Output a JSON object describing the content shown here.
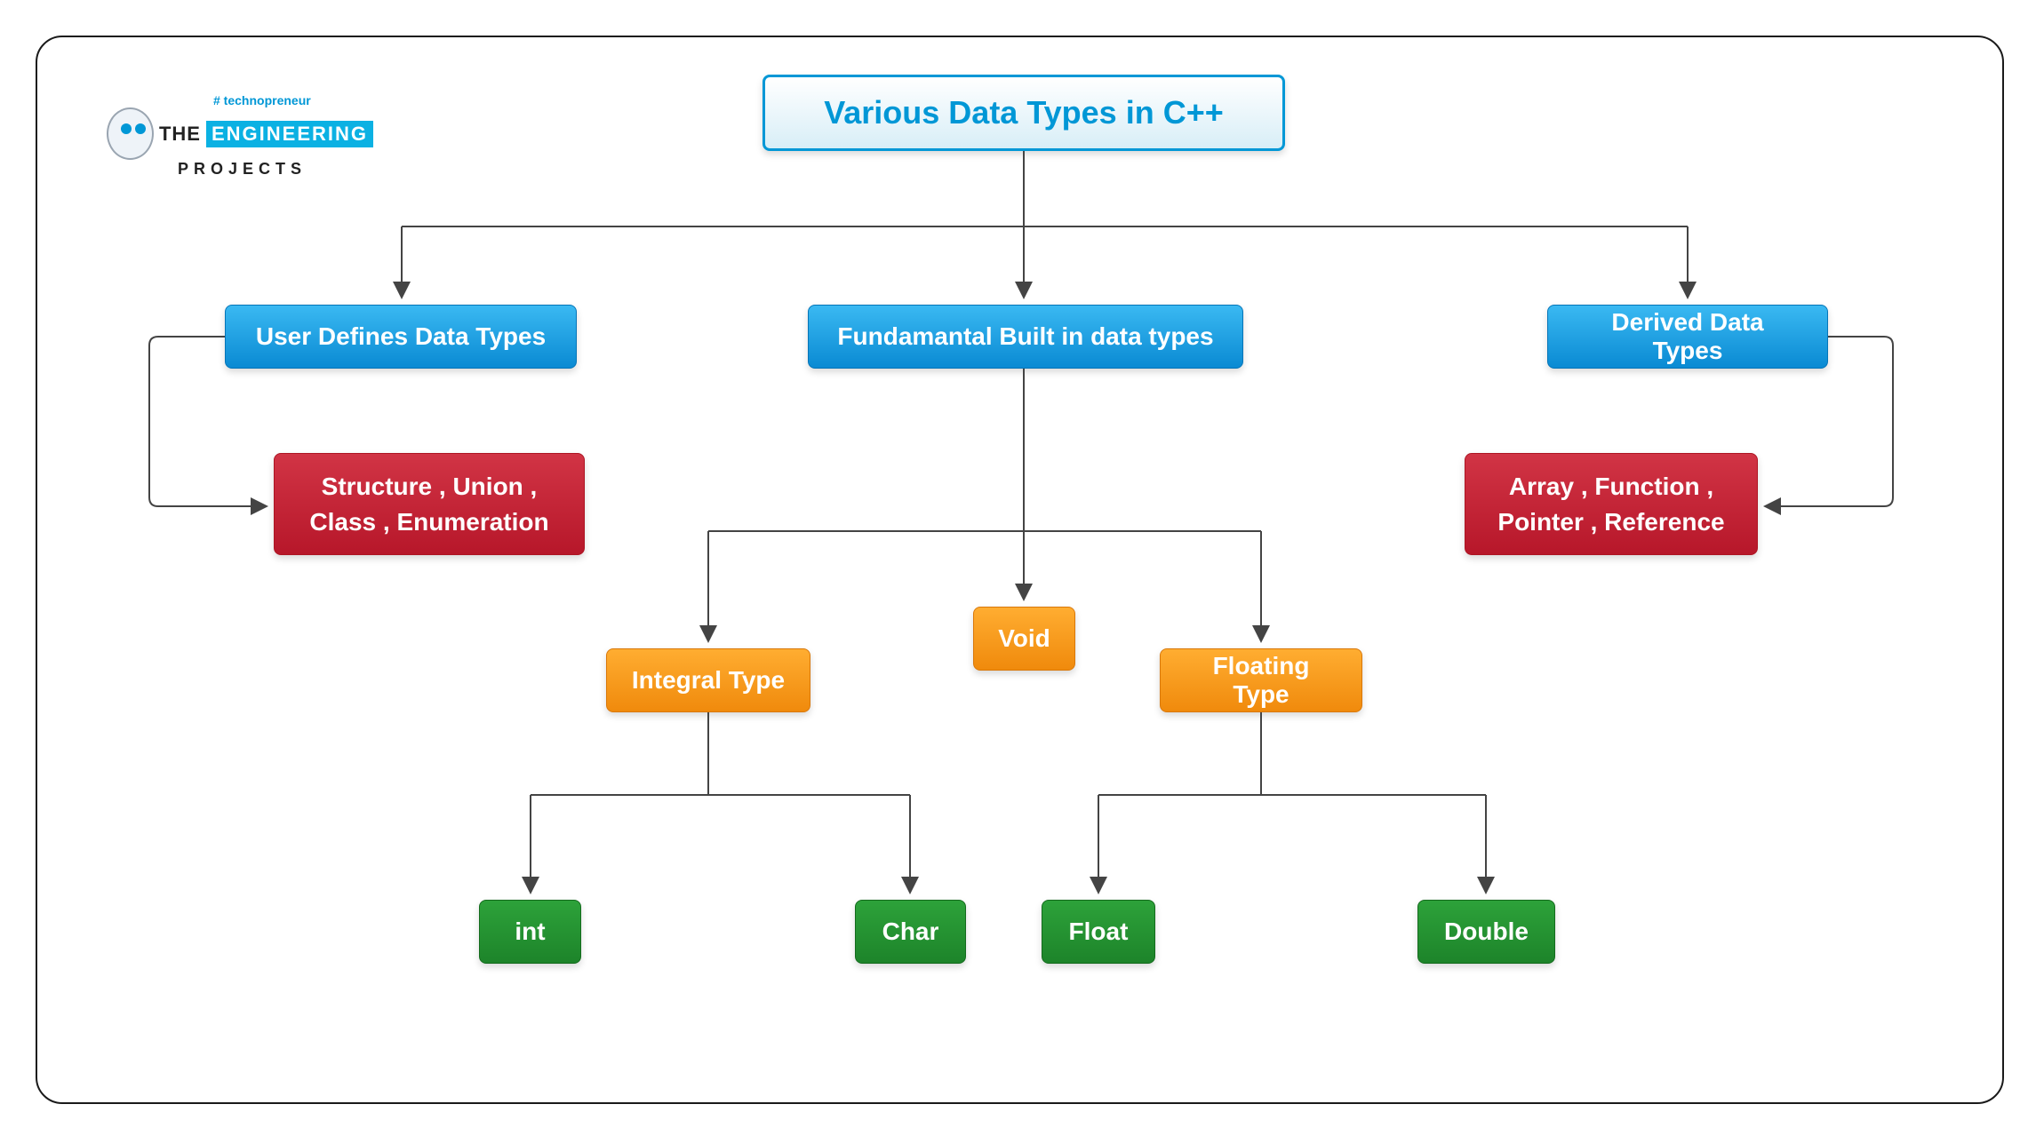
{
  "logo": {
    "hash": "# technopreneur",
    "the": "THE",
    "eng": "ENGINEERING",
    "projects": "PROJECTS"
  },
  "root": "Various Data Types in C++",
  "level1": {
    "user": "User Defines Data Types",
    "fund": "Fundamantal Built in data types",
    "derived": "Derived Data Types"
  },
  "level2": {
    "user_items": "Structure , Union , Class , Enumeration",
    "derived_items": "Array , Function , Pointer , Reference",
    "integral": "Integral Type",
    "void": "Void",
    "floating": "Floating Type"
  },
  "leaves": {
    "int": "int",
    "char": "Char",
    "float": "Float",
    "double": "Double"
  },
  "colors": {
    "accent": "#0097d6",
    "blue": "#0a8ad3",
    "red": "#b7172a",
    "orange": "#f08a0c",
    "green": "#1d842a"
  }
}
